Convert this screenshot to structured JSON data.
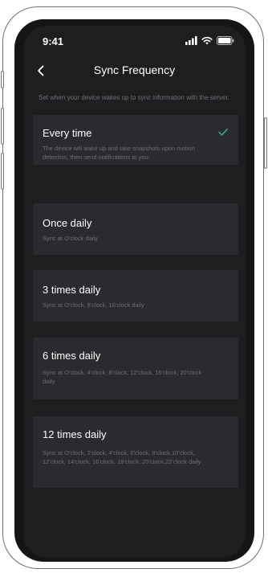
{
  "status_bar": {
    "time": "9:41",
    "icons": [
      "signal-icon",
      "wifi-icon",
      "battery-icon"
    ]
  },
  "nav": {
    "title": "Sync Frequency",
    "back_icon": "chevron-left-icon"
  },
  "description": "Set when your device wakes up to sync information with the server.",
  "options": [
    {
      "title": "Every time",
      "description": "The device will wake up and take snapshots upon motion detection, then send notifications to you.",
      "selected": true
    },
    {
      "title": "Once daily",
      "description": "Sync at O'clock daily",
      "selected": false
    },
    {
      "title": "3 times daily",
      "description": "Sync at O'clock, 8'clock, 16'clock daily",
      "selected": false
    },
    {
      "title": "6 times daily",
      "description": "Sync at O'clock, 4'clock, 8'clock, 12'clock, 16'clock, 20'clock daily",
      "selected": false
    },
    {
      "title": "12 times daily",
      "description": "Sync at O'clock, 2'clock, 4'clock, 6'clock, 8'clock,10'clock, 12'clock, 14'clock, 16'clock, 18'clock, 20'clock,22'clock daily",
      "selected": false
    }
  ],
  "colors": {
    "background": "#1d1e20",
    "card": "#2a2b2e",
    "accent_check": "#3fb38a",
    "secondary_text": "#6d6f74"
  }
}
